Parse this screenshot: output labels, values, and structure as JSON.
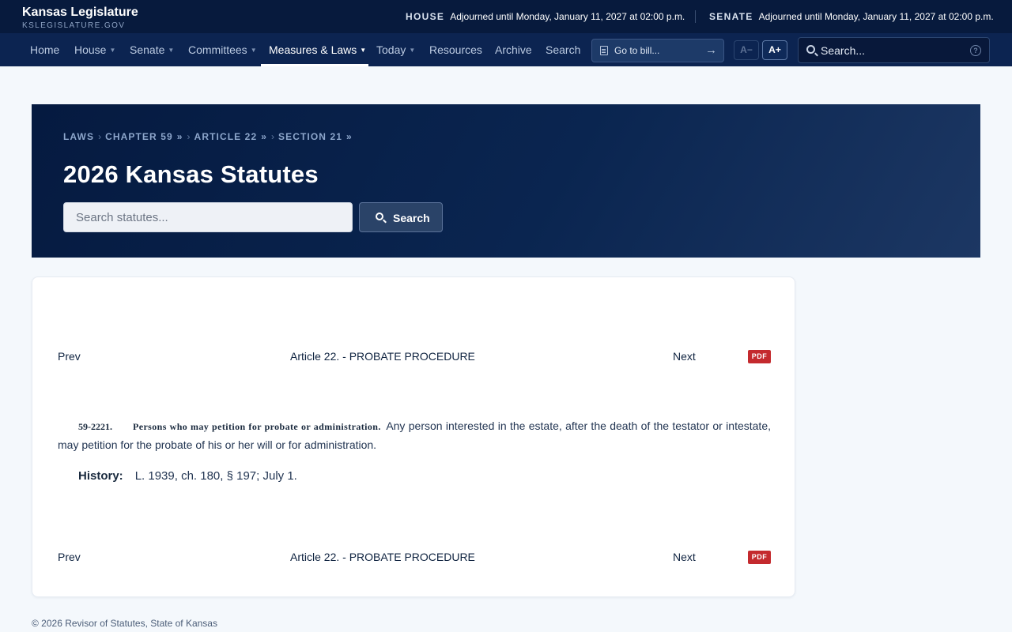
{
  "header": {
    "title": "Kansas Legislature",
    "subtitle": "KSLEGISLATURE.GOV",
    "house": {
      "label": "HOUSE",
      "status": "Adjourned until Monday, January 11, 2027 at 02:00 p.m."
    },
    "senate": {
      "label": "SENATE",
      "status": "Adjourned until Monday, January 11, 2027 at 02:00 p.m."
    }
  },
  "nav": {
    "items": [
      {
        "label": "Home"
      },
      {
        "label": "House"
      },
      {
        "label": "Senate"
      },
      {
        "label": "Committees"
      },
      {
        "label": "Measures & Laws",
        "active": true
      },
      {
        "label": "Today"
      },
      {
        "label": "Resources"
      },
      {
        "label": "Archive"
      },
      {
        "label": "Search"
      }
    ],
    "goto_bill_label": "Go to bill...",
    "font_decrease_label": "A−",
    "font_increase_label": "A+",
    "search_placeholder": "Search...",
    "help_label": "?"
  },
  "hero": {
    "breadcrumb": [
      "LAWS",
      "CHAPTER 59",
      "ARTICLE 22",
      "SECTION 21"
    ],
    "breadcrumb_separator": "›",
    "breadcrumb_suffix": "»",
    "title": "2026 Kansas Statutes",
    "search_placeholder": "Search statutes...",
    "search_button": "Search"
  },
  "statute": {
    "pager": {
      "prev": "Prev",
      "article": "Article 22. - PROBATE PROCEDURE",
      "next": "Next",
      "pdf": "PDF"
    },
    "section_number": "59-2221.",
    "catchline": "Persons who may petition for probate or administration.",
    "text": "Any person interested in the estate, after the death of the testator or intestate, may petition for the probate of his or her will or for administration.",
    "history_label": "History:",
    "history": "L. 1939, ch. 180, § 197; July 1."
  },
  "footer": {
    "text": "© 2026 Revisor of Statutes, State of Kansas"
  },
  "colors": {
    "topbar": "#071a3d",
    "navbar": "#0c2451",
    "hero": "#0a2550",
    "pdf": "#c42a2e",
    "page_bg": "#f4f8fc"
  }
}
